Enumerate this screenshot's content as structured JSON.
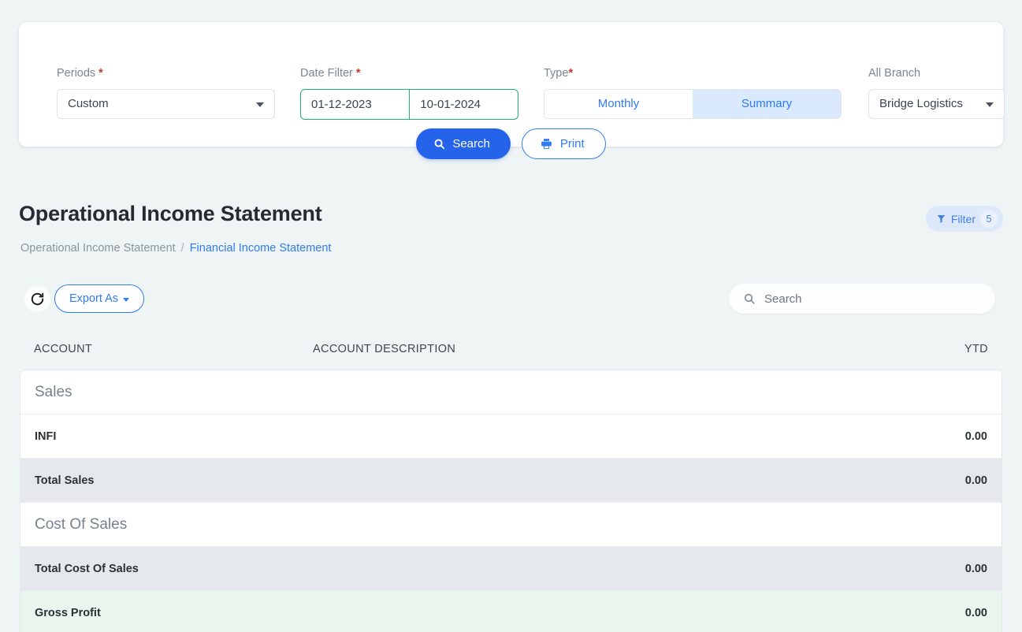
{
  "filters": {
    "periods": {
      "label": "Periods",
      "required_mark": "*",
      "value": "Custom"
    },
    "date_filter": {
      "label": "Date Filter",
      "required_mark": "*",
      "from": "01-12-2023",
      "to": "10-01-2024"
    },
    "type": {
      "label": "Type",
      "required_mark": "*",
      "options": [
        "Monthly",
        "Summary"
      ],
      "selected": "Summary"
    },
    "branch": {
      "label": "All Branch",
      "value": "Bridge Logistics"
    },
    "search_button": "Search",
    "print_button": "Print"
  },
  "header": {
    "title": "Operational Income Statement",
    "breadcrumb": {
      "root": "Operational Income Statement",
      "separator": "/",
      "current": "Financial Income Statement"
    },
    "filter_pill": {
      "label": "Filter",
      "count": "5"
    }
  },
  "toolbar": {
    "export_label": "Export As",
    "search_placeholder": "Search",
    "search_value": ""
  },
  "table": {
    "columns": [
      "ACCOUNT",
      "ACCOUNT DESCRIPTION",
      "YTD"
    ],
    "rows": [
      {
        "type": "group",
        "account": "Sales",
        "description": "",
        "ytd": ""
      },
      {
        "type": "data",
        "account": "INFI",
        "description": "",
        "ytd": "0.00"
      },
      {
        "type": "total",
        "account": "Total Sales",
        "description": "",
        "ytd": "0.00"
      },
      {
        "type": "group",
        "account": "Cost Of Sales",
        "description": "",
        "ytd": ""
      },
      {
        "type": "total",
        "account": "Total Cost Of Sales",
        "description": "",
        "ytd": "0.00"
      },
      {
        "type": "highlight",
        "account": "Gross Profit",
        "description": "",
        "ytd": "0.00"
      }
    ]
  },
  "colors": {
    "page_background": "#eff4f4",
    "primary_blue": "#2563eb",
    "link_blue": "#2f7bf6",
    "date_border_green": "#21b573",
    "required_red": "#c0392b",
    "total_row": "#e5e9ed",
    "highlight_row": "#e8f6ed"
  }
}
